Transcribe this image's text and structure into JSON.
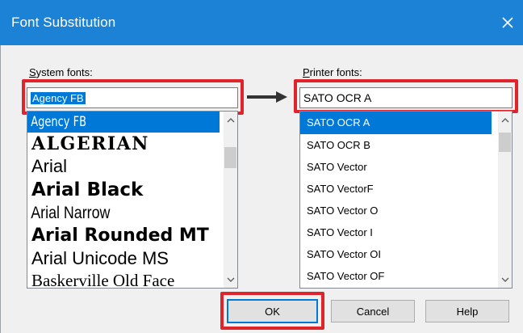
{
  "window": {
    "title": "Font Substitution",
    "close_icon": "close-icon",
    "title_bar_color": "#1b82d6"
  },
  "system_fonts": {
    "label": "System fonts:",
    "value": "Agency FB",
    "items": [
      {
        "label": "Agency FB",
        "selected": true
      },
      {
        "label": "ALGERIAN",
        "selected": false
      },
      {
        "label": "Arial",
        "selected": false
      },
      {
        "label": "Arial Black",
        "selected": false
      },
      {
        "label": "Arial Narrow",
        "selected": false
      },
      {
        "label": "Arial Rounded MT",
        "selected": false
      },
      {
        "label": "Arial Unicode MS",
        "selected": false
      },
      {
        "label": "Baskerville Old Face",
        "selected": false
      }
    ]
  },
  "printer_fonts": {
    "label": "Printer fonts:",
    "value": "SATO OCR A",
    "items": [
      {
        "label": "SATO OCR A",
        "selected": true
      },
      {
        "label": "SATO OCR B",
        "selected": false
      },
      {
        "label": "SATO Vector",
        "selected": false
      },
      {
        "label": "SATO VectorF",
        "selected": false
      },
      {
        "label": "SATO Vector O",
        "selected": false
      },
      {
        "label": "SATO Vector I",
        "selected": false
      },
      {
        "label": "SATO Vector OI",
        "selected": false
      },
      {
        "label": "SATO Vector OF",
        "selected": false
      }
    ]
  },
  "buttons": {
    "ok": "OK",
    "cancel": "Cancel",
    "help": "Help"
  },
  "icons": {
    "arrow": "arrow-right-icon",
    "scroll_up": "chevron-up-icon",
    "scroll_down": "chevron-down-icon"
  },
  "colors": {
    "highlight_frame": "#e0242b",
    "selection": "#0078d7"
  }
}
